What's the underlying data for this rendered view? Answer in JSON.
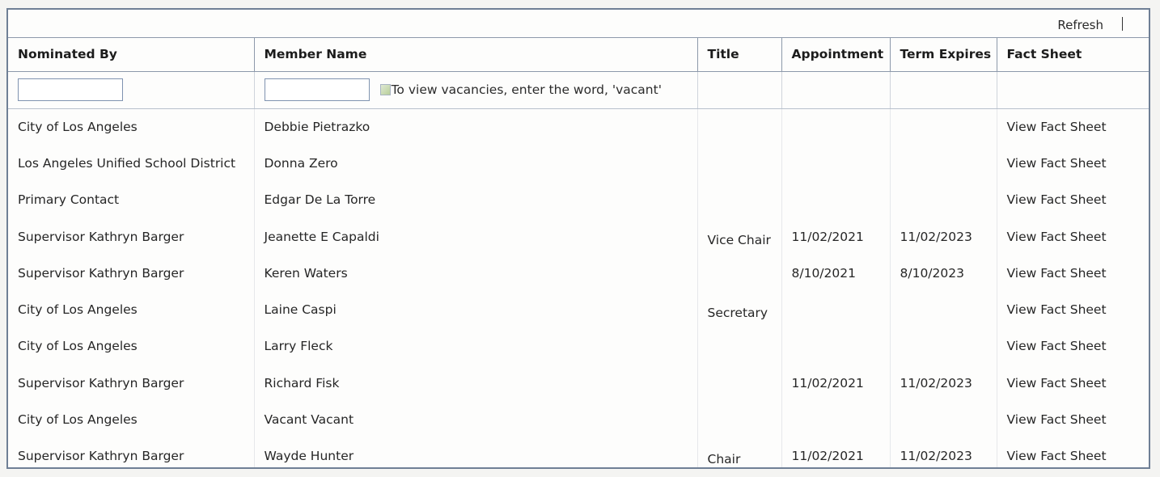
{
  "toolbar": {
    "refresh_label": "Refresh"
  },
  "columns": {
    "nominated_by": "Nominated By",
    "member_name": "Member Name",
    "title": "Title",
    "appointment": "Appointment",
    "term_expires": "Term Expires",
    "fact_sheet": "Fact Sheet"
  },
  "filters": {
    "nominated_by_value": "",
    "member_name_value": "",
    "member_hint": "To view vacancies, enter the word, 'vacant'"
  },
  "rows": [
    {
      "nominated_by": "City of Los Angeles",
      "member_name": "Debbie Pietrazko",
      "title": "",
      "appointment": "",
      "term_expires": "",
      "fact_sheet": "View Fact Sheet"
    },
    {
      "nominated_by": "Los Angeles Unified School District",
      "member_name": "Donna Zero",
      "title": "",
      "appointment": "",
      "term_expires": "",
      "fact_sheet": "View Fact Sheet"
    },
    {
      "nominated_by": "Primary Contact",
      "member_name": "Edgar De La Torre",
      "title": "",
      "appointment": "",
      "term_expires": "",
      "fact_sheet": "View Fact Sheet"
    },
    {
      "nominated_by": "Supervisor Kathryn Barger",
      "member_name": "Jeanette E Capaldi",
      "title": "Vice Chair",
      "appointment": "11/02/2021",
      "term_expires": "11/02/2023",
      "fact_sheet": "View Fact Sheet"
    },
    {
      "nominated_by": "Supervisor Kathryn Barger",
      "member_name": "Keren Waters",
      "title": "",
      "appointment": "8/10/2021",
      "term_expires": "8/10/2023",
      "fact_sheet": "View Fact Sheet"
    },
    {
      "nominated_by": "City of Los Angeles",
      "member_name": "Laine Caspi",
      "title": "Secretary",
      "appointment": "",
      "term_expires": "",
      "fact_sheet": "View Fact Sheet"
    },
    {
      "nominated_by": "City of Los Angeles",
      "member_name": "Larry Fleck",
      "title": "",
      "appointment": "",
      "term_expires": "",
      "fact_sheet": "View Fact Sheet"
    },
    {
      "nominated_by": "Supervisor Kathryn Barger",
      "member_name": "Richard Fisk",
      "title": "",
      "appointment": "11/02/2021",
      "term_expires": "11/02/2023",
      "fact_sheet": "View Fact Sheet"
    },
    {
      "nominated_by": "City of Los Angeles",
      "member_name": "Vacant Vacant",
      "title": "",
      "appointment": "",
      "term_expires": "",
      "fact_sheet": "View Fact Sheet"
    },
    {
      "nominated_by": "Supervisor Kathryn Barger",
      "member_name": "Wayde Hunter",
      "title": "Chair",
      "appointment": "11/02/2021",
      "term_expires": "11/02/2023",
      "fact_sheet": "View Fact Sheet"
    }
  ]
}
